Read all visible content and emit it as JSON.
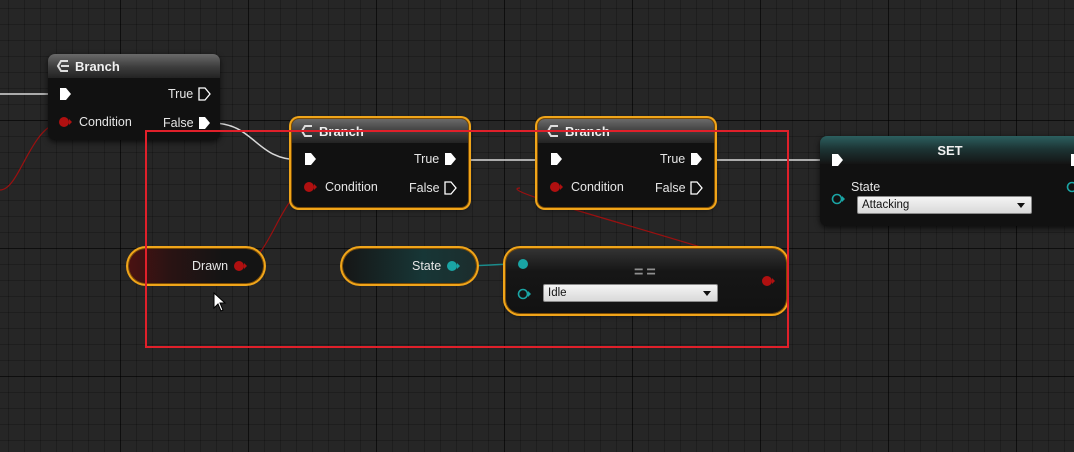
{
  "nodes": {
    "branch1": {
      "title": "Branch",
      "condition_label": "Condition",
      "true_label": "True",
      "false_label": "False"
    },
    "branch2": {
      "title": "Branch",
      "condition_label": "Condition",
      "true_label": "True",
      "false_label": "False"
    },
    "branch3": {
      "title": "Branch",
      "condition_label": "Condition",
      "true_label": "True",
      "false_label": "False"
    },
    "set": {
      "title": "SET",
      "state_label": "State",
      "dropdown_value": "Attacking"
    },
    "drawn": {
      "label": "Drawn"
    },
    "state_get": {
      "label": "State"
    },
    "equal": {
      "symbol": "==",
      "dropdown_value": "Idle"
    }
  },
  "colors": {
    "bool_pin": "#a00e0e",
    "enum_pin": "#00a0a0",
    "exec_pin": "#ffffff",
    "selection_outline": "#f0a51a",
    "annotation_box": "#e0202a"
  },
  "icons": {
    "branch_icon": "branch-icon",
    "exec_pin": "exec-pin-icon",
    "bool_pin": "bool-pin-icon",
    "enum_pin": "enum-pin-icon",
    "cursor": "mouse-cursor-icon"
  }
}
